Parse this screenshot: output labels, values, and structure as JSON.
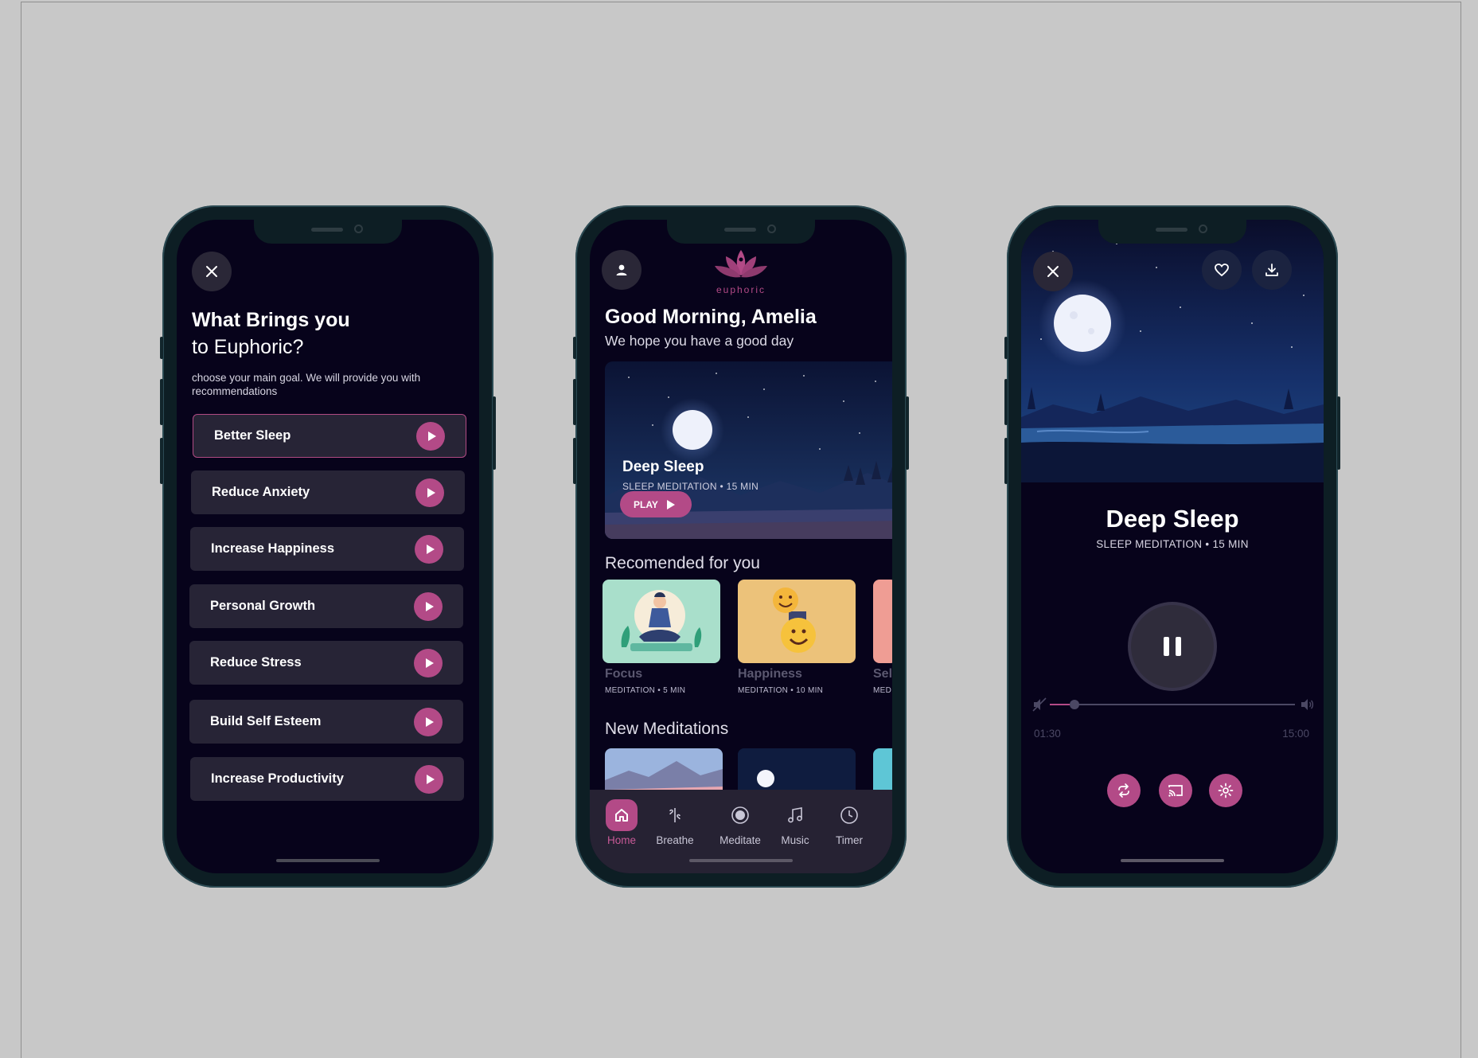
{
  "onboarding": {
    "title": "What Brings you",
    "subtitle": "to Euphoric?",
    "description": "choose your main goal. We will provide you with recommendations",
    "goals": [
      {
        "label": "Better Sleep",
        "selected": true
      },
      {
        "label": "Reduce Anxiety",
        "selected": false
      },
      {
        "label": "Increase Happiness",
        "selected": false
      },
      {
        "label": "Personal Growth",
        "selected": false
      },
      {
        "label": "Reduce Stress",
        "selected": false
      },
      {
        "label": "Build Self Esteem",
        "selected": false
      },
      {
        "label": "Increase Productivity",
        "selected": false
      }
    ]
  },
  "home": {
    "brand": "euphoric",
    "greeting": "Good Morning, Amelia",
    "greeting_sub": "We hope you have a good day",
    "featured": {
      "title": "Deep Sleep",
      "meta": "SLEEP MEDITATION  •  15 MIN",
      "play_label": "PLAY"
    },
    "recommended_heading": "Recomended for you",
    "recommended": [
      {
        "title": "Focus",
        "meta": "MEDITATION  • 5 MIN"
      },
      {
        "title": "Happiness",
        "meta": "MEDITATION • 10 MIN"
      },
      {
        "title": "Self",
        "meta": "MEDI"
      }
    ],
    "new_heading": "New Meditations",
    "nav": [
      {
        "label": "Home",
        "icon": "home-icon",
        "active": true
      },
      {
        "label": "Breathe",
        "icon": "breathe-icon",
        "active": false
      },
      {
        "label": "Meditate",
        "icon": "meditate-icon",
        "active": false
      },
      {
        "label": "Music",
        "icon": "music-icon",
        "active": false
      },
      {
        "label": "Timer",
        "icon": "timer-icon",
        "active": false
      }
    ]
  },
  "player": {
    "title": "Deep Sleep",
    "meta": "SLEEP MEDITATION  •  15 MIN",
    "elapsed": "01:30",
    "duration": "15:00",
    "progress": 0.1
  },
  "colors": {
    "accent": "#b34a87",
    "screen_bg": "#07031b",
    "card_bg": "#272436",
    "page_bg": "#c8c8c8"
  }
}
